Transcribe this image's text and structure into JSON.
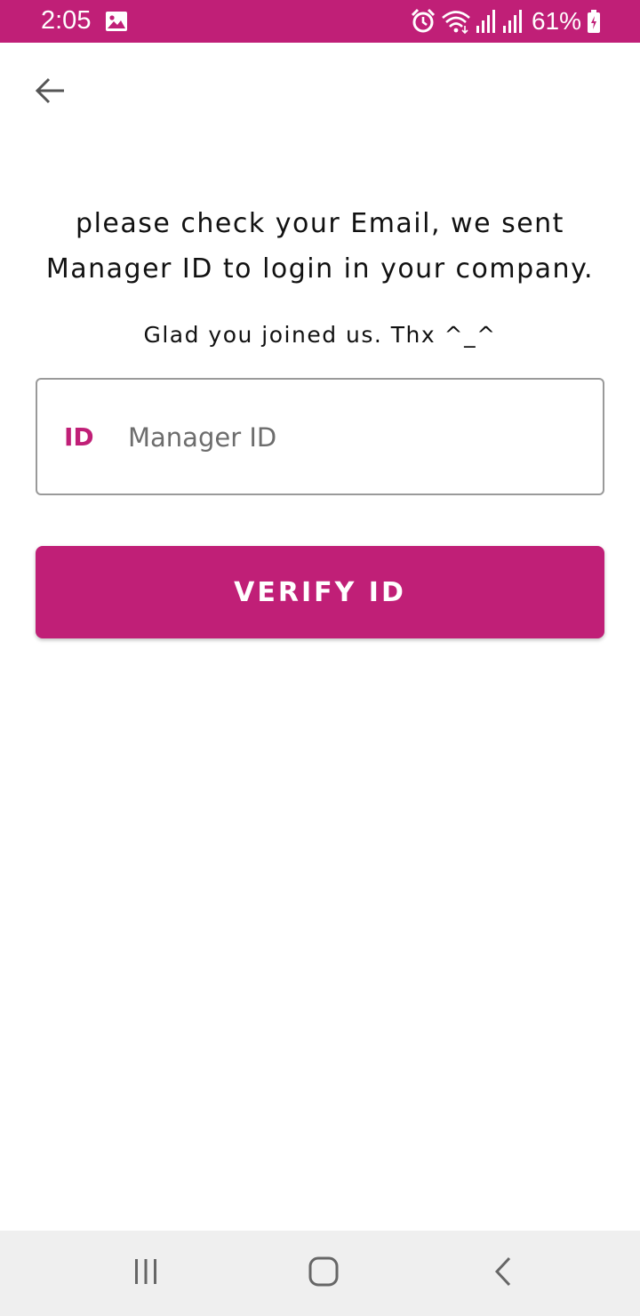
{
  "theme": {
    "accent": "#c01f77"
  },
  "status_bar": {
    "time": "2:05",
    "battery_percent": "61%",
    "icons": [
      "gallery-icon",
      "alarm-icon",
      "wifi-icon",
      "signal-icon",
      "signal-icon",
      "battery-charging-icon"
    ]
  },
  "header": {
    "back_icon": "arrow-left-icon"
  },
  "main": {
    "message": "please check your Email, we sent Manager ID to login in your company.",
    "subtext": "Glad you joined us. Thx ^_^",
    "id_field": {
      "prefix": "ID",
      "placeholder": "Manager ID",
      "value": ""
    },
    "verify_button": "VERIFY ID"
  },
  "nav_bar": {
    "icons": [
      "recent-apps-icon",
      "home-icon",
      "back-icon"
    ]
  }
}
